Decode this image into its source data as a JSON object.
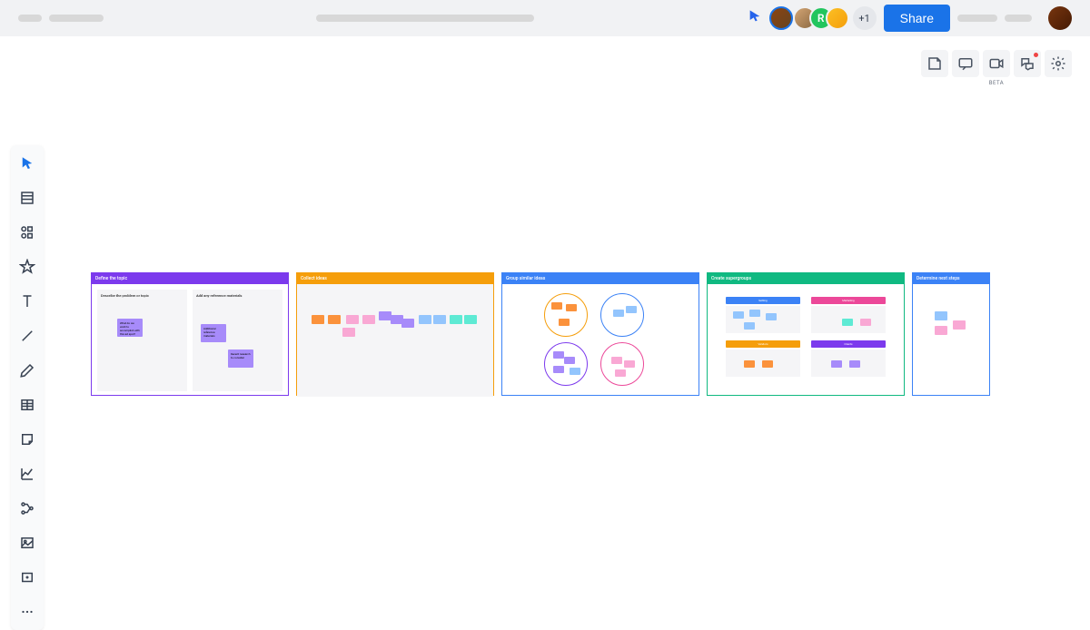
{
  "header": {
    "share_label": "Share",
    "avatar_letter": "R",
    "more_count": "+1"
  },
  "top_tools": {
    "beta_label": "BETA"
  },
  "frames": {
    "f1": {
      "title": "Define the topic",
      "col1_title": "Describe the problem or topic",
      "col2_title": "Add any reference materials",
      "sticky1": "What do we want to accomplish with this ad spot?",
      "sticky2": "Additional reference materials",
      "sticky3": "Recent research to consider"
    },
    "f2": {
      "title": "Collect ideas"
    },
    "f3": {
      "title": "Group similar ideas"
    },
    "f4": {
      "title": "Create supergroups",
      "cat1": "Setting",
      "cat2": "Marketing",
      "cat3": "Vendors",
      "cat4": "Clients"
    },
    "f5": {
      "title": "Determine next steps"
    }
  },
  "colors": {
    "purple": "#7c3aed",
    "orange": "#f59e0b",
    "blue": "#3b82f6",
    "green": "#10b981",
    "sticky_purple": "#a78bfa",
    "sticky_orange": "#fb923c",
    "sticky_pink": "#f9a8d4",
    "sticky_teal": "#5eead4",
    "sticky_lightblue": "#93c5fd"
  }
}
